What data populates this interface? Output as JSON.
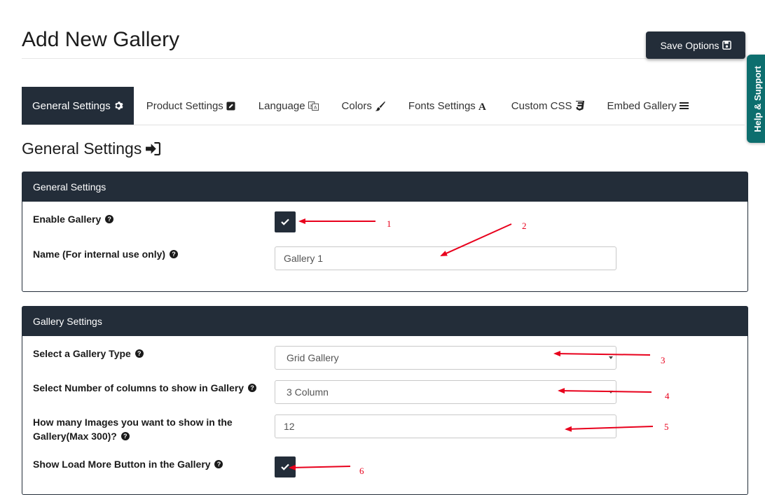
{
  "page": {
    "title": "Add New Gallery",
    "save_label": "Save Options",
    "help_label": "Help & Support"
  },
  "tabs": [
    {
      "label": "General Settings",
      "icon": "gear-icon",
      "active": true
    },
    {
      "label": "Product Settings",
      "icon": "edit-icon",
      "active": false
    },
    {
      "label": "Language",
      "icon": "language-icon",
      "active": false
    },
    {
      "label": "Colors",
      "icon": "brush-icon",
      "active": false
    },
    {
      "label": "Fonts Settings",
      "icon": "font-icon",
      "active": false
    },
    {
      "label": "Custom CSS",
      "icon": "css3-icon",
      "active": false
    },
    {
      "label": "Embed Gallery",
      "icon": "menu-icon",
      "active": false
    }
  ],
  "section": {
    "title": "General Settings"
  },
  "general_panel": {
    "header": "General Settings",
    "enable_label": "Enable Gallery",
    "enable_checked": true,
    "name_label": "Name (For internal use only)",
    "name_value": "Gallery 1"
  },
  "gallery_panel": {
    "header": "Gallery Settings",
    "type_label": "Select a Gallery Type",
    "type_value": "Grid Gallery",
    "columns_label": "Select Number of columns to show in Gallery",
    "columns_value": "3 Column",
    "images_label_line1": "How many Images you want to show in the",
    "images_label_line2": "Gallery(Max 300)?",
    "images_value": "12",
    "loadmore_label": "Show Load More Button in the Gallery",
    "loadmore_checked": true
  },
  "annotations": [
    "1",
    "2",
    "3",
    "4",
    "5",
    "6"
  ],
  "colors": {
    "dark": "#232d39",
    "help_tab": "#0d6e6e",
    "annotation": "#e8001c"
  }
}
